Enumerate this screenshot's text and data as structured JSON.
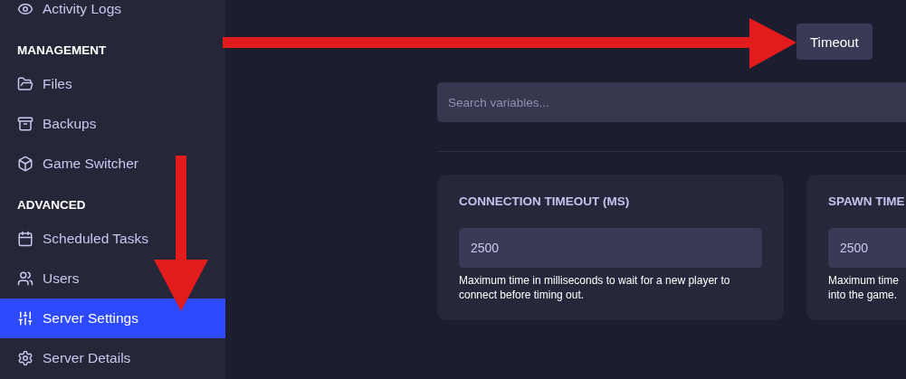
{
  "sidebar": {
    "sections": [
      {
        "items": [
          {
            "label": "Activity Logs",
            "selected": false
          }
        ]
      },
      {
        "heading": "MANAGEMENT",
        "items": [
          {
            "label": "Files",
            "selected": false
          },
          {
            "label": "Backups",
            "selected": false
          },
          {
            "label": "Game Switcher",
            "selected": false
          }
        ]
      },
      {
        "heading": "ADVANCED",
        "items": [
          {
            "label": "Scheduled Tasks",
            "selected": false
          },
          {
            "label": "Users",
            "selected": false
          },
          {
            "label": "Server Settings",
            "selected": true
          },
          {
            "label": "Server Details",
            "selected": false
          }
        ]
      }
    ]
  },
  "tabs": [
    {
      "label": "Timeout",
      "selected": true
    }
  ],
  "search": {
    "placeholder": "Search variables..."
  },
  "cards": [
    {
      "title": "CONNECTION TIMEOUT (MS)",
      "value": "2500",
      "description": [
        "Maximum time in milliseconds to wait for a new player to",
        "connect before timing out."
      ]
    },
    {
      "title": "SPAWN TIME",
      "value": "2500",
      "description": [
        "Maximum time",
        "into the game."
      ]
    }
  ]
}
